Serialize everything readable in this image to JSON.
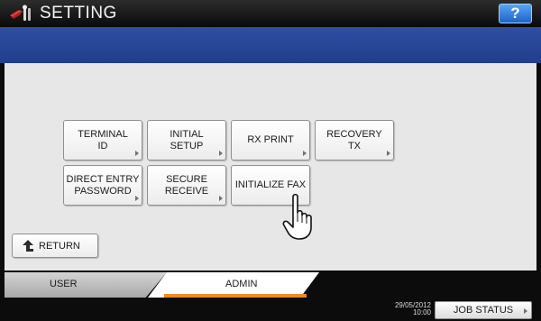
{
  "header": {
    "title": "SETTING",
    "help_label": "?"
  },
  "fax_buttons": [
    {
      "label": "TERMINAL\nID",
      "icon": "chevron-right-icon"
    },
    {
      "label": "INITIAL\nSETUP",
      "icon": "chevron-right-icon"
    },
    {
      "label": "RX PRINT",
      "icon": "chevron-right-icon"
    },
    {
      "label": "RECOVERY\nTX",
      "icon": "chevron-right-icon"
    },
    {
      "label": "DIRECT ENTRY\nPASSWORD",
      "icon": "chevron-right-icon"
    },
    {
      "label": "SECURE\nRECEIVE",
      "icon": "chevron-right-icon"
    },
    {
      "label": "INITIALIZE FAX"
    }
  ],
  "return_label": "RETURN",
  "tabs": {
    "user": "USER",
    "admin": "ADMIN",
    "active": "ADMIN"
  },
  "status": {
    "date": "29/05/2012",
    "time": "10:00",
    "job_status": "JOB STATUS"
  },
  "colors": {
    "header_band": "#2a4597",
    "help_button": "#2f7ee0",
    "admin_tab_accent": "#f08a22"
  },
  "pointer": "hand-pointer-icon"
}
